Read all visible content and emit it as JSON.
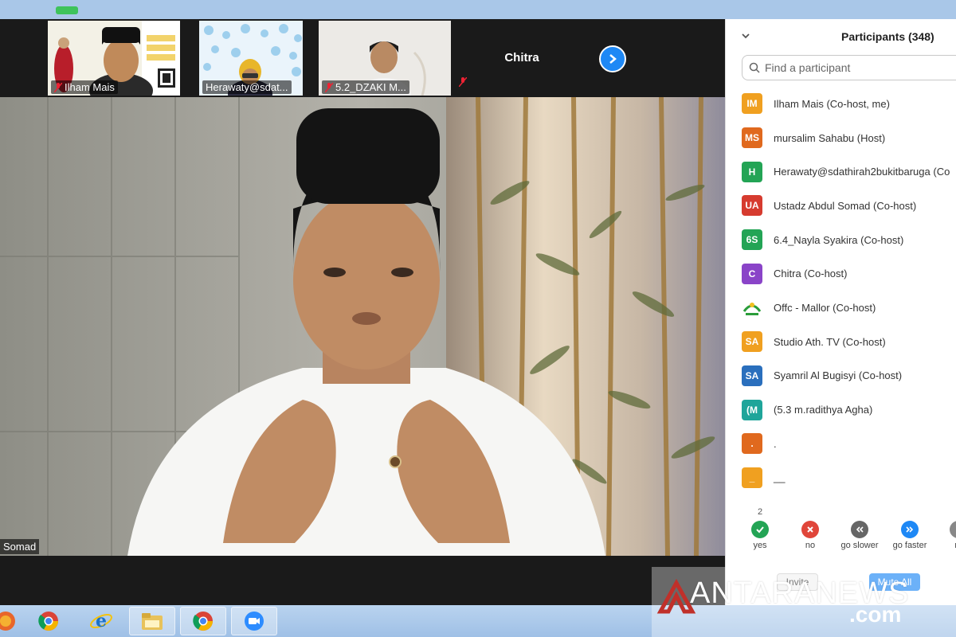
{
  "thumbnails": [
    {
      "name": "Ilham Mais"
    },
    {
      "name": "Herawaty@sdat..."
    },
    {
      "name": "5.2_DZAKI M..."
    }
  ],
  "thumbnail_plain": {
    "name": "Chitra"
  },
  "speaker": {
    "name": "Somad"
  },
  "participants_panel": {
    "title": "Participants (348)",
    "search_placeholder": "Find a participant",
    "items": [
      {
        "initials": "IM",
        "name": "Ilham Mais (Co-host, me)",
        "color": "#f0a020"
      },
      {
        "initials": "MS",
        "name": "mursalim Sahabu (Host)",
        "color": "#e0691e"
      },
      {
        "initials": "H",
        "name": "Herawaty@sdathirah2bukitbaruga (Co",
        "color": "#23a455"
      },
      {
        "initials": "UA",
        "name": "Ustadz Abdul Somad (Co-host)",
        "color": "#d63b2f"
      },
      {
        "initials": "6S",
        "name": "6.4_Nayla Syakira (Co-host)",
        "color": "#23a455"
      },
      {
        "initials": "C",
        "name": "Chitra (Co-host)",
        "color": "#8a44c8"
      },
      {
        "initials": "",
        "name": "Offc - Mallor (Co-host)",
        "color": "#ffffff"
      },
      {
        "initials": "SA",
        "name": "Studio Ath. TV (Co-host)",
        "color": "#f0a020"
      },
      {
        "initials": "SA",
        "name": "Syamril Al Bugisyi (Co-host)",
        "color": "#2a6fbd"
      },
      {
        "initials": "(M",
        "name": "(5.3 m.radithya Agha)",
        "color": "#1fa59a"
      },
      {
        "initials": ".",
        "name": ".",
        "color": "#e0691e"
      },
      {
        "initials": "_",
        "name": "__",
        "color": "#f0a020"
      }
    ],
    "reactions": [
      {
        "label": "yes",
        "icon": "check-icon",
        "color": "#23a455"
      },
      {
        "label": "no",
        "icon": "x-icon",
        "color": "#e0463a"
      },
      {
        "label": "go slower",
        "icon": "rewind-icon",
        "color": "#666666"
      },
      {
        "label": "go faster",
        "icon": "fast-forward-icon",
        "color": "#1e88f5"
      },
      {
        "label": "m",
        "icon": "more-icon",
        "color": "#888888"
      }
    ],
    "yes_count": "2",
    "invite_label": "Invite",
    "mute_all_label": "Mute All"
  },
  "watermark": {
    "text": "ANTARANEWS",
    "suffix": ".com"
  },
  "taskbar": {
    "apps": [
      "firefox-icon",
      "chrome-icon",
      "ie-icon",
      "folder-icon",
      "chrome-icon",
      "zoom-icon"
    ]
  }
}
